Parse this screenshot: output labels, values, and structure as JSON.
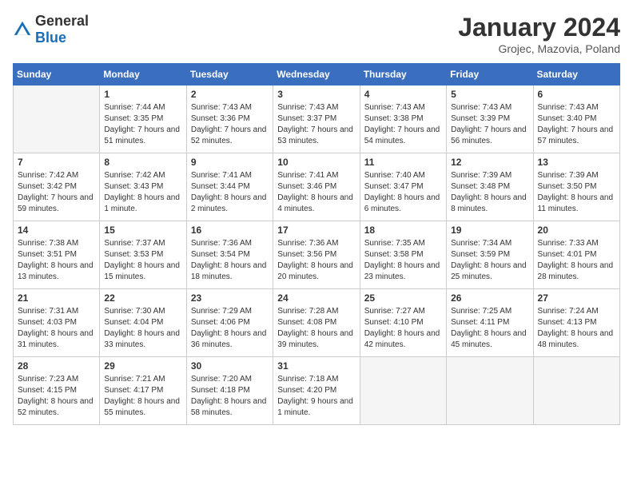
{
  "header": {
    "logo_general": "General",
    "logo_blue": "Blue",
    "month_title": "January 2024",
    "location": "Grojec, Mazovia, Poland"
  },
  "days_of_week": [
    "Sunday",
    "Monday",
    "Tuesday",
    "Wednesday",
    "Thursday",
    "Friday",
    "Saturday"
  ],
  "weeks": [
    [
      {
        "num": "",
        "content": "",
        "empty": true
      },
      {
        "num": "1",
        "content": "Sunrise: 7:44 AM\nSunset: 3:35 PM\nDaylight: 7 hours\nand 51 minutes."
      },
      {
        "num": "2",
        "content": "Sunrise: 7:43 AM\nSunset: 3:36 PM\nDaylight: 7 hours\nand 52 minutes."
      },
      {
        "num": "3",
        "content": "Sunrise: 7:43 AM\nSunset: 3:37 PM\nDaylight: 7 hours\nand 53 minutes."
      },
      {
        "num": "4",
        "content": "Sunrise: 7:43 AM\nSunset: 3:38 PM\nDaylight: 7 hours\nand 54 minutes."
      },
      {
        "num": "5",
        "content": "Sunrise: 7:43 AM\nSunset: 3:39 PM\nDaylight: 7 hours\nand 56 minutes."
      },
      {
        "num": "6",
        "content": "Sunrise: 7:43 AM\nSunset: 3:40 PM\nDaylight: 7 hours\nand 57 minutes."
      }
    ],
    [
      {
        "num": "7",
        "content": "Sunrise: 7:42 AM\nSunset: 3:42 PM\nDaylight: 7 hours\nand 59 minutes."
      },
      {
        "num": "8",
        "content": "Sunrise: 7:42 AM\nSunset: 3:43 PM\nDaylight: 8 hours\nand 1 minute."
      },
      {
        "num": "9",
        "content": "Sunrise: 7:41 AM\nSunset: 3:44 PM\nDaylight: 8 hours\nand 2 minutes."
      },
      {
        "num": "10",
        "content": "Sunrise: 7:41 AM\nSunset: 3:46 PM\nDaylight: 8 hours\nand 4 minutes."
      },
      {
        "num": "11",
        "content": "Sunrise: 7:40 AM\nSunset: 3:47 PM\nDaylight: 8 hours\nand 6 minutes."
      },
      {
        "num": "12",
        "content": "Sunrise: 7:39 AM\nSunset: 3:48 PM\nDaylight: 8 hours\nand 8 minutes."
      },
      {
        "num": "13",
        "content": "Sunrise: 7:39 AM\nSunset: 3:50 PM\nDaylight: 8 hours\nand 11 minutes."
      }
    ],
    [
      {
        "num": "14",
        "content": "Sunrise: 7:38 AM\nSunset: 3:51 PM\nDaylight: 8 hours\nand 13 minutes."
      },
      {
        "num": "15",
        "content": "Sunrise: 7:37 AM\nSunset: 3:53 PM\nDaylight: 8 hours\nand 15 minutes."
      },
      {
        "num": "16",
        "content": "Sunrise: 7:36 AM\nSunset: 3:54 PM\nDaylight: 8 hours\nand 18 minutes."
      },
      {
        "num": "17",
        "content": "Sunrise: 7:36 AM\nSunset: 3:56 PM\nDaylight: 8 hours\nand 20 minutes."
      },
      {
        "num": "18",
        "content": "Sunrise: 7:35 AM\nSunset: 3:58 PM\nDaylight: 8 hours\nand 23 minutes."
      },
      {
        "num": "19",
        "content": "Sunrise: 7:34 AM\nSunset: 3:59 PM\nDaylight: 8 hours\nand 25 minutes."
      },
      {
        "num": "20",
        "content": "Sunrise: 7:33 AM\nSunset: 4:01 PM\nDaylight: 8 hours\nand 28 minutes."
      }
    ],
    [
      {
        "num": "21",
        "content": "Sunrise: 7:31 AM\nSunset: 4:03 PM\nDaylight: 8 hours\nand 31 minutes."
      },
      {
        "num": "22",
        "content": "Sunrise: 7:30 AM\nSunset: 4:04 PM\nDaylight: 8 hours\nand 33 minutes."
      },
      {
        "num": "23",
        "content": "Sunrise: 7:29 AM\nSunset: 4:06 PM\nDaylight: 8 hours\nand 36 minutes."
      },
      {
        "num": "24",
        "content": "Sunrise: 7:28 AM\nSunset: 4:08 PM\nDaylight: 8 hours\nand 39 minutes."
      },
      {
        "num": "25",
        "content": "Sunrise: 7:27 AM\nSunset: 4:10 PM\nDaylight: 8 hours\nand 42 minutes."
      },
      {
        "num": "26",
        "content": "Sunrise: 7:25 AM\nSunset: 4:11 PM\nDaylight: 8 hours\nand 45 minutes."
      },
      {
        "num": "27",
        "content": "Sunrise: 7:24 AM\nSunset: 4:13 PM\nDaylight: 8 hours\nand 48 minutes."
      }
    ],
    [
      {
        "num": "28",
        "content": "Sunrise: 7:23 AM\nSunset: 4:15 PM\nDaylight: 8 hours\nand 52 minutes."
      },
      {
        "num": "29",
        "content": "Sunrise: 7:21 AM\nSunset: 4:17 PM\nDaylight: 8 hours\nand 55 minutes."
      },
      {
        "num": "30",
        "content": "Sunrise: 7:20 AM\nSunset: 4:18 PM\nDaylight: 8 hours\nand 58 minutes."
      },
      {
        "num": "31",
        "content": "Sunrise: 7:18 AM\nSunset: 4:20 PM\nDaylight: 9 hours\nand 1 minute."
      },
      {
        "num": "",
        "content": "",
        "empty": true
      },
      {
        "num": "",
        "content": "",
        "empty": true
      },
      {
        "num": "",
        "content": "",
        "empty": true
      }
    ]
  ]
}
